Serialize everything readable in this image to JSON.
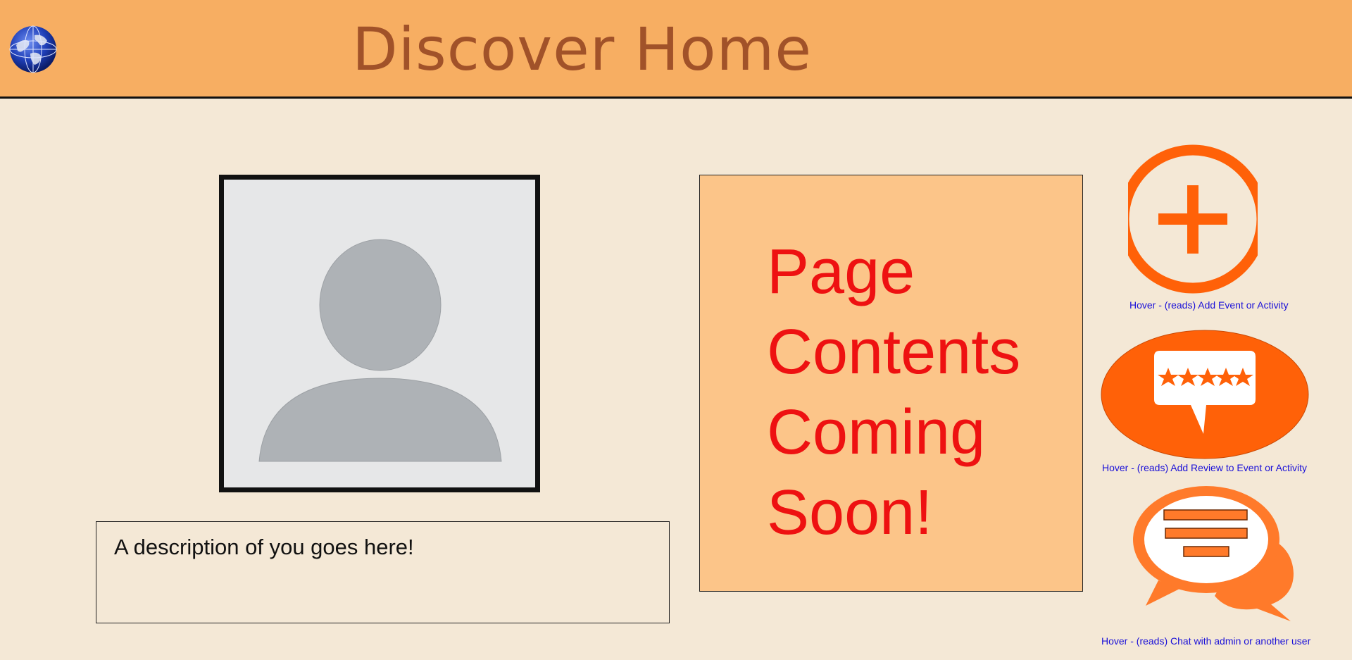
{
  "header": {
    "title": "Discover Home",
    "logo_icon": "globe-icon",
    "background_color": "#f7ae62",
    "title_color": "#a15229"
  },
  "profile": {
    "avatar_icon": "user-placeholder-icon",
    "description": "A description of you goes here!"
  },
  "main": {
    "coming_soon_lines": [
      "Page",
      "Contents",
      "Coming",
      "Soon!"
    ],
    "coming_soon_color": "#ee1111",
    "panel_color": "#fcc589"
  },
  "actions": [
    {
      "icon": "add-circle-icon",
      "caption": "Hover - (reads) Add Event or Activity"
    },
    {
      "icon": "review-stars-icon",
      "caption": "Hover - (reads) Add Review to Event or Activity"
    },
    {
      "icon": "chat-bubbles-icon",
      "caption": "Hover - (reads) Chat with admin or another user"
    }
  ],
  "colors": {
    "accent_orange": "#ff6108",
    "caption_blue": "#1a10d8",
    "page_background": "#f4e8d6"
  }
}
